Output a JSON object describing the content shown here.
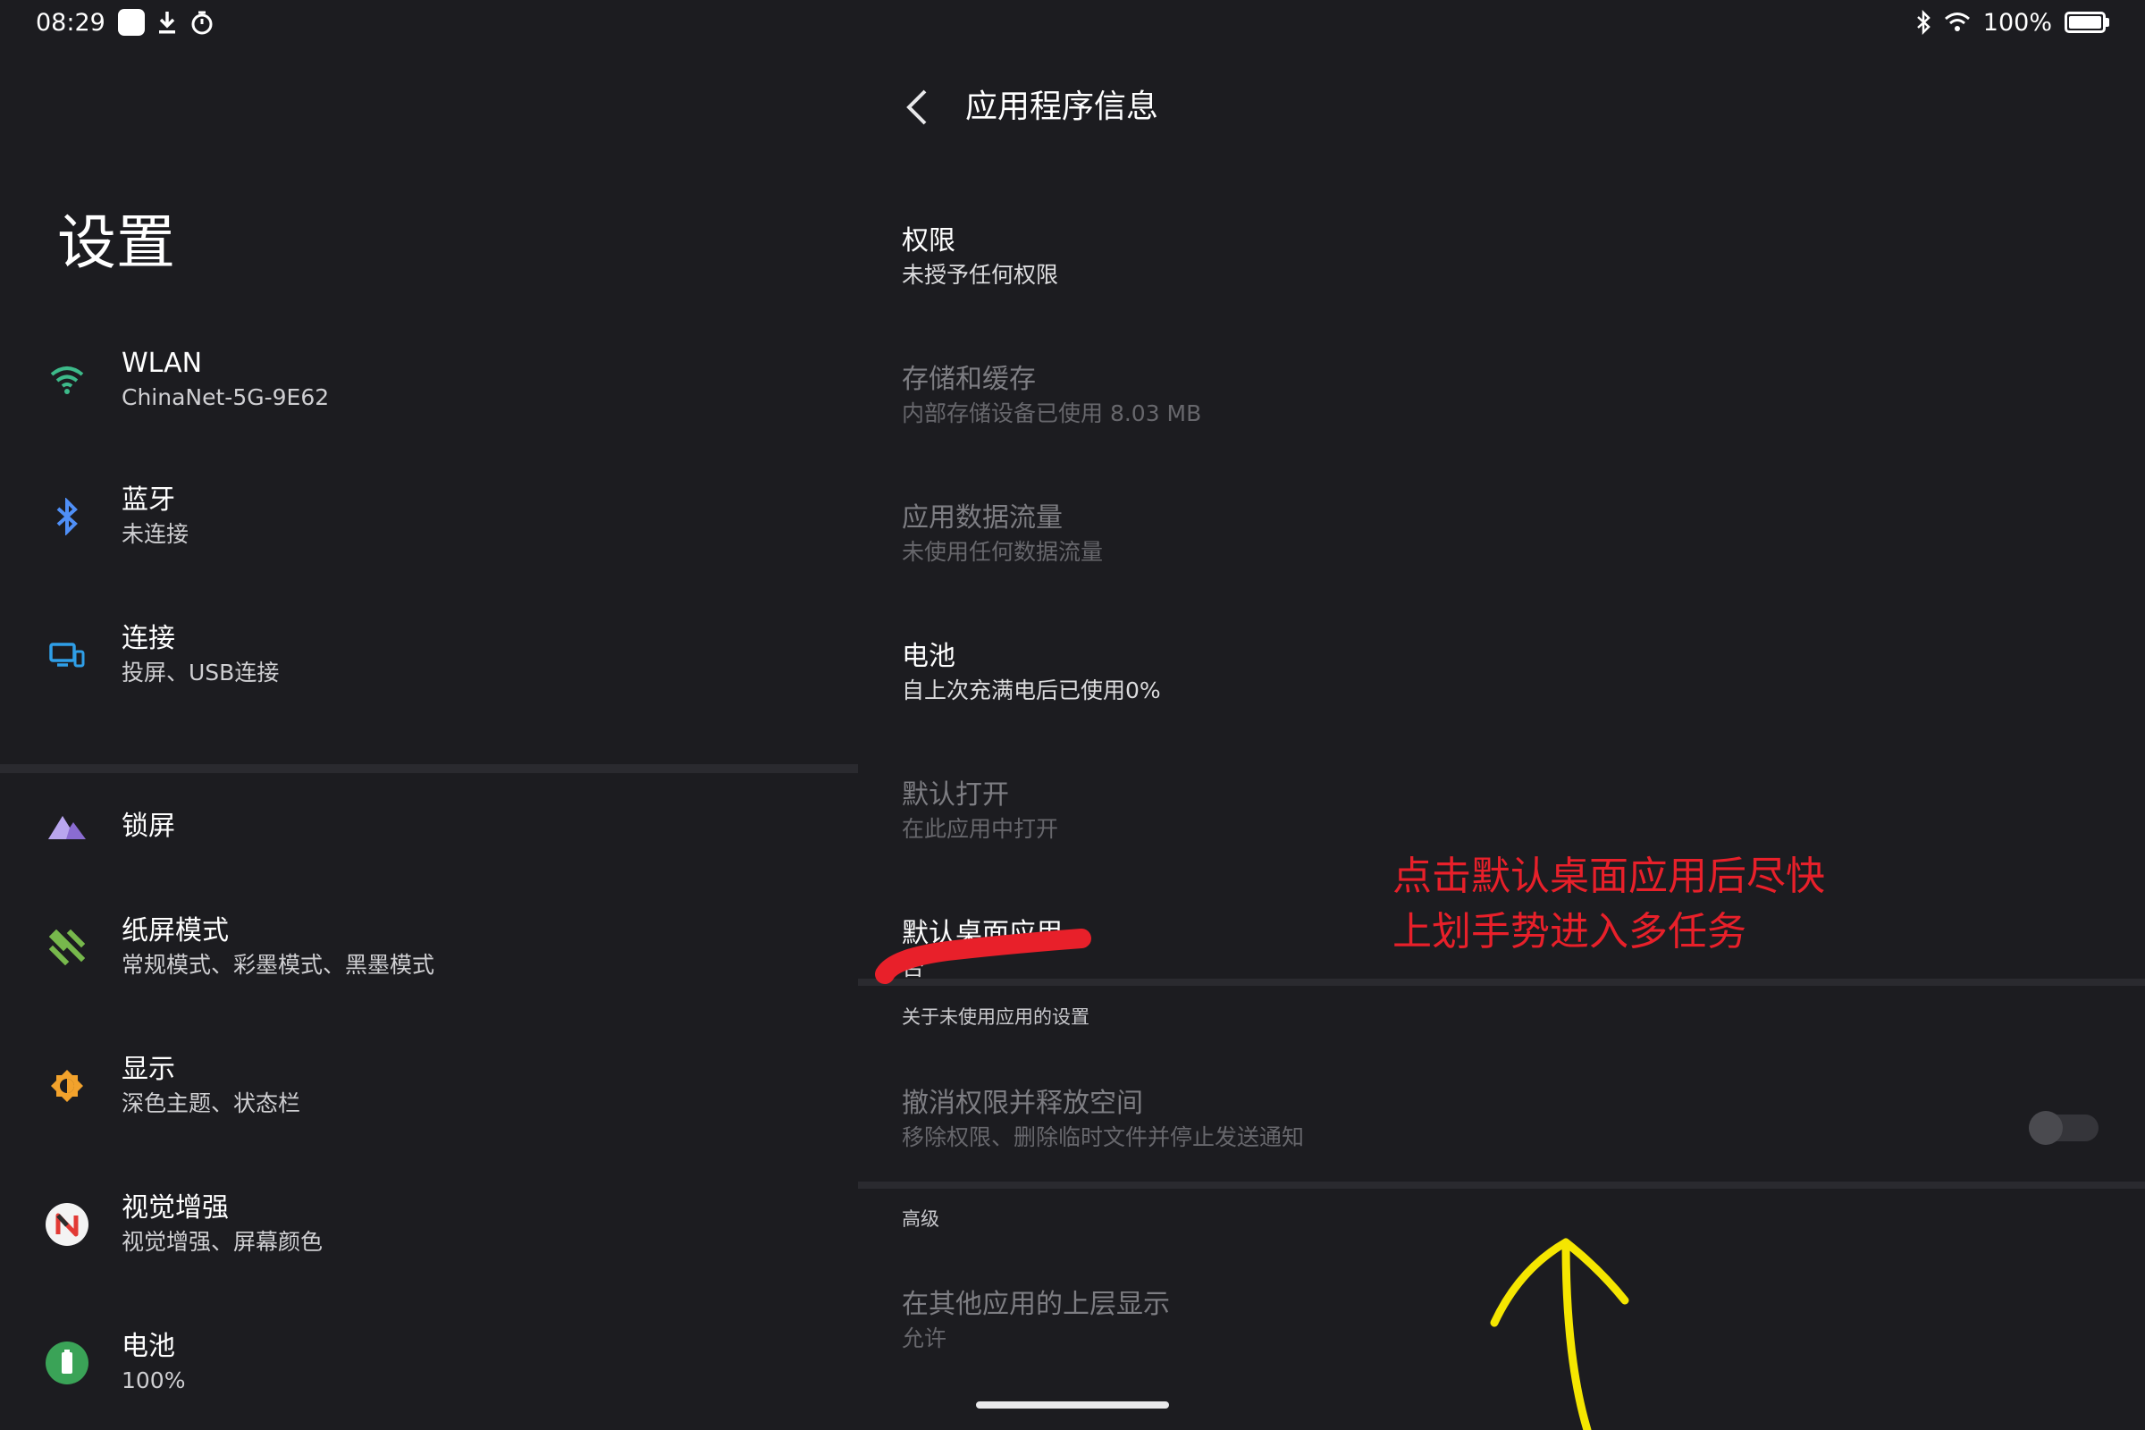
{
  "status_bar": {
    "time": "08:29",
    "battery_percent": "100%",
    "icons": [
      "notification-square-icon",
      "download-icon",
      "timer-icon",
      "bluetooth-icon",
      "wifi-icon",
      "battery-icon"
    ]
  },
  "left": {
    "title": "设置",
    "items": [
      {
        "title": "WLAN",
        "subtitle": "ChinaNet-5G-9E62",
        "icon": "wifi-icon"
      },
      {
        "title": "蓝牙",
        "subtitle": "未连接",
        "icon": "bluetooth-icon"
      },
      {
        "title": "连接",
        "subtitle": "投屏、USB连接",
        "icon": "cast-icon"
      },
      {
        "title": "锁屏",
        "subtitle": "",
        "icon": "lockscreen-mountain-icon"
      },
      {
        "title": "纸屏模式",
        "subtitle": "常规模式、彩墨模式、黑墨模式",
        "icon": "paper-stripes-icon"
      },
      {
        "title": "显示",
        "subtitle": "深色主题、状态栏",
        "icon": "brightness-icon"
      },
      {
        "title": "视觉增强",
        "subtitle": "视觉增强、屏幕颜色",
        "icon": "visual-enhance-icon"
      },
      {
        "title": "电池",
        "subtitle": "100%",
        "icon": "battery-icon"
      }
    ],
    "colors": {
      "wifi": "#3dba8a",
      "bluetooth": "#4f8ff7",
      "connect": "#2f9fe8",
      "lock": "#8a6cd1",
      "paper": "#77b84c",
      "display": "#f2a22c",
      "battery": "#3aa357"
    }
  },
  "right": {
    "header_title": "应用程序信息",
    "items": [
      {
        "title": "权限",
        "subtitle": "未授予任何权限",
        "enabled": true
      },
      {
        "title": "存储和缓存",
        "subtitle": "内部存储设备已使用 8.03 MB",
        "enabled": false
      },
      {
        "title": "应用数据流量",
        "subtitle": "未使用任何数据流量",
        "enabled": false
      },
      {
        "title": "电池",
        "subtitle": "自上次充满电后已使用0%",
        "enabled": true
      },
      {
        "title": "默认打开",
        "subtitle": "在此应用中打开",
        "enabled": false
      },
      {
        "title": "默认桌面应用",
        "subtitle": "否",
        "enabled": true
      }
    ],
    "section_unused": "关于未使用应用的设置",
    "revoke": {
      "title": "撤消权限并释放空间",
      "subtitle": "移除权限、删除临时文件并停止发送通知",
      "toggle_on": false
    },
    "section_advanced": "高级",
    "overlay": {
      "title": "在其他应用的上层显示",
      "subtitle": "允许"
    }
  },
  "annotation": {
    "line1": "点击默认桌面应用后尽快",
    "line2": "上划手势进入多任务",
    "text_color": "#e8202a",
    "arrow_color": "#f5e600",
    "underline_color": "#e8202a"
  }
}
